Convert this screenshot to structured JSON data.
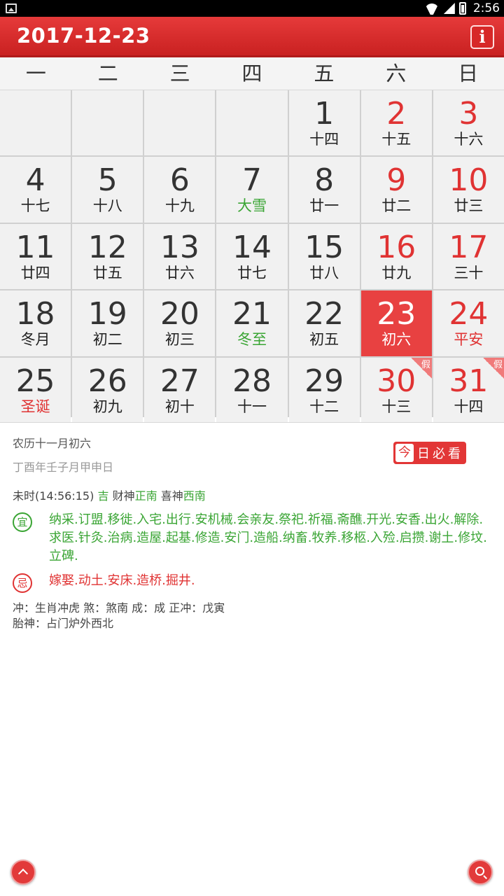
{
  "status_bar": {
    "time": "2:56"
  },
  "header": {
    "title": "2017-12-23",
    "info_label": "i"
  },
  "weekdays": [
    "一",
    "二",
    "三",
    "四",
    "五",
    "六",
    "日"
  ],
  "calendar": {
    "rows": [
      [
        {
          "day": "",
          "sub": ""
        },
        {
          "day": "",
          "sub": ""
        },
        {
          "day": "",
          "sub": ""
        },
        {
          "day": "",
          "sub": ""
        },
        {
          "day": "1",
          "sub": "十四"
        },
        {
          "day": "2",
          "sub": "十五"
        },
        {
          "day": "3",
          "sub": "十六"
        }
      ],
      [
        {
          "day": "4",
          "sub": "十七"
        },
        {
          "day": "5",
          "sub": "十八"
        },
        {
          "day": "6",
          "sub": "十九"
        },
        {
          "day": "7",
          "sub": "大雪"
        },
        {
          "day": "8",
          "sub": "廿一"
        },
        {
          "day": "9",
          "sub": "廿二"
        },
        {
          "day": "10",
          "sub": "廿三"
        }
      ],
      [
        {
          "day": "11",
          "sub": "廿四"
        },
        {
          "day": "12",
          "sub": "廿五"
        },
        {
          "day": "13",
          "sub": "廿六"
        },
        {
          "day": "14",
          "sub": "廿七"
        },
        {
          "day": "15",
          "sub": "廿八"
        },
        {
          "day": "16",
          "sub": "廿九"
        },
        {
          "day": "17",
          "sub": "三十"
        }
      ],
      [
        {
          "day": "18",
          "sub": "冬月"
        },
        {
          "day": "19",
          "sub": "初二"
        },
        {
          "day": "20",
          "sub": "初三"
        },
        {
          "day": "21",
          "sub": "冬至"
        },
        {
          "day": "22",
          "sub": "初五"
        },
        {
          "day": "23",
          "sub": "初六"
        },
        {
          "day": "24",
          "sub": "平安"
        }
      ],
      [
        {
          "day": "25",
          "sub": "圣诞"
        },
        {
          "day": "26",
          "sub": "初九"
        },
        {
          "day": "27",
          "sub": "初十"
        },
        {
          "day": "28",
          "sub": "十一"
        },
        {
          "day": "29",
          "sub": "十二"
        },
        {
          "day": "30",
          "sub": "十三",
          "tag": "假"
        },
        {
          "day": "31",
          "sub": "十四",
          "tag": "假"
        }
      ]
    ]
  },
  "details": {
    "lunar_date": "农历十一月初六",
    "ganzhi": "丁酉年壬子月甲申日",
    "must_read": {
      "first": "今",
      "rest": "日必看"
    },
    "time_prefix": "未时(14:56:15)",
    "luck": "吉",
    "caishen_label": "财神",
    "caishen_dir": "正南",
    "xishen_label": "喜神",
    "xishen_dir": "西南",
    "yi_icon": "宜",
    "yi_text": "纳采.订盟.移徙.入宅.出行.安机械.会亲友.祭祀.祈福.斋醮.开光.安香.出火.解除.求医.针灸.治病.造屋.起基.修造.安门.造船.纳畜.牧养.移柩.入殓.启攒.谢土.修坟.立碑.",
    "ji_icon": "忌",
    "ji_text": "嫁娶.动土.安床.造桥.掘井.",
    "chong_line": "冲：生肖冲虎   煞：煞南   成：成   正冲：戊寅",
    "taishen_line": "胎神：占门炉外西北"
  },
  "colors": {
    "accent": "#e23636",
    "green": "#3aa534",
    "selected": "#e84141"
  }
}
